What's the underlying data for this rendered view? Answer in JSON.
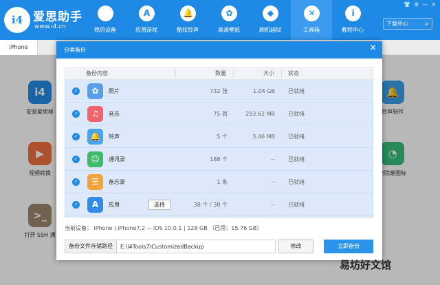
{
  "app": {
    "brand_name": "爱思助手",
    "brand_url": "www.i4.cn",
    "logo_text": "i4",
    "window_controls": [
      "👕",
      "⚙",
      "—",
      "✕"
    ],
    "download_label": "下载中心",
    "download_count": ">"
  },
  "nav": [
    {
      "label": "我的设备",
      "icon": "apple-icon",
      "glyph": ""
    },
    {
      "label": "应用游戏",
      "icon": "app-store-icon",
      "glyph": "A"
    },
    {
      "label": "酷炫铃声",
      "icon": "bell-icon",
      "glyph": "🔔"
    },
    {
      "label": "高清壁纸",
      "icon": "flower-icon",
      "glyph": "✿"
    },
    {
      "label": "刷机越狱",
      "icon": "dropbox-icon",
      "glyph": "◆"
    },
    {
      "label": "工具箱",
      "icon": "tools-icon",
      "glyph": "✕"
    },
    {
      "label": "教程中心",
      "icon": "info-icon",
      "glyph": "i"
    }
  ],
  "tabs": {
    "device": "iPhone"
  },
  "tools": {
    "left": [
      {
        "label": "安装爱思移",
        "icon": "i4-logo-icon",
        "glyph": "i4",
        "color": "#2589e3"
      },
      {
        "label": "视频转换",
        "icon": "play-icon",
        "glyph": "▶",
        "color": "#f07040"
      },
      {
        "label": "打开 SSH 通",
        "icon": "terminal-icon",
        "glyph": ">_",
        "color": "#9a8a70"
      }
    ],
    "right": [
      {
        "label": "铃声制作",
        "icon": "bell-icon",
        "glyph": "🔔",
        "color": "#3aa0ea"
      },
      {
        "label": "删除废图标",
        "icon": "clock-icon",
        "glyph": "◔",
        "color": "#34c07a"
      }
    ]
  },
  "dialog": {
    "title": "分类备份",
    "close": "×",
    "columns": {
      "content": "备份内容",
      "count": "数量",
      "size": "大小",
      "status": "状态"
    },
    "rows": [
      {
        "name": "照片",
        "count": "732 张",
        "size": "1.04 GB",
        "status": "已就绪",
        "icon": "photos-icon",
        "glyph": "✿",
        "color": "#5aa0e8"
      },
      {
        "name": "音乐",
        "count": "75 首",
        "size": "293.62 MB",
        "status": "已就绪",
        "icon": "music-icon",
        "glyph": "♫",
        "color": "#f0646e"
      },
      {
        "name": "铃声",
        "count": "5 个",
        "size": "3.46 MB",
        "status": "已就绪",
        "icon": "bell-icon",
        "glyph": "🔔",
        "color": "#48a4ee"
      },
      {
        "name": "通讯录",
        "count": "188 个",
        "size": "--",
        "status": "已就绪",
        "icon": "contacts-icon",
        "glyph": "☺",
        "color": "#3dbb6a"
      },
      {
        "name": "备忘录",
        "count": "1 条",
        "size": "--",
        "status": "已就绪",
        "icon": "notes-icon",
        "glyph": "☰",
        "color": "#f2a33a"
      },
      {
        "name": "应用",
        "count": "38 个 / 38 个",
        "size": "--",
        "status": "已就绪",
        "icon": "app-store-icon",
        "glyph": "A",
        "color": "#2f8ce8",
        "select_label": "选择"
      }
    ],
    "device_info": "当前设备：  iPhone    |    iPhone7,2 ~ iOS 10.0.1    |    128 GB （已用：15.76 GB）",
    "path_label": "备份文件存储路径",
    "path_value": "E:\\i4Tools7\\CustomizedBackup",
    "modify_label": "修改",
    "backup_label": "立即备份"
  },
  "watermark": "易坊好文馆"
}
